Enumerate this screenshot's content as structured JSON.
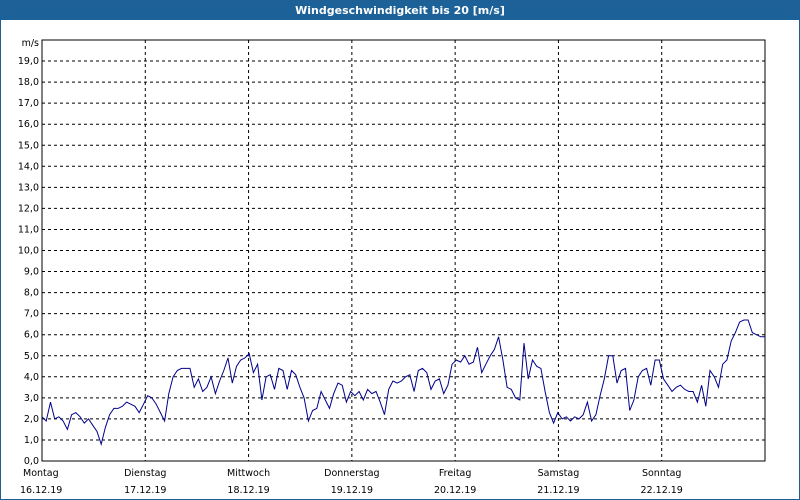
{
  "window": {
    "title": "Windgeschwindigkeit bis 20 [m/s]"
  },
  "chart_data": {
    "type": "line",
    "title": "Windgeschwindigkeit bis 20 [m/s]",
    "ylabel": "m/s",
    "ylim": [
      0,
      20
    ],
    "yticks": [
      "0,0",
      "1,0",
      "2,0",
      "3,0",
      "4,0",
      "5,0",
      "6,0",
      "7,0",
      "8,0",
      "9,0",
      "10,0",
      "11,0",
      "12,0",
      "13,0",
      "14,0",
      "15,0",
      "16,0",
      "17,0",
      "18,0",
      "19,0"
    ],
    "xlim": [
      0,
      7
    ],
    "days": [
      {
        "day": "Montag",
        "date": "16.12.19"
      },
      {
        "day": "Dienstag",
        "date": "17.12.19"
      },
      {
        "day": "Mittwoch",
        "date": "18.12.19"
      },
      {
        "day": "Donnerstag",
        "date": "19.12.19"
      },
      {
        "day": "Freitag",
        "date": "20.12.19"
      },
      {
        "day": "Samstag",
        "date": "21.12.19"
      },
      {
        "day": "Sonntag",
        "date": "22.12.19"
      }
    ],
    "grid": true,
    "color": "#00008b",
    "series": [
      {
        "values": [
          2.1,
          1.9,
          2.8,
          2.0,
          2.1,
          1.9,
          1.5,
          2.2,
          2.3,
          2.1,
          1.8,
          2.0,
          1.7,
          1.4,
          0.8,
          1.6,
          2.2,
          2.5,
          2.5,
          2.6,
          2.8,
          2.7,
          2.6,
          2.3,
          2.7,
          3.1,
          3.0,
          2.7,
          2.3,
          1.9,
          3.2,
          4.0,
          4.3,
          4.4,
          4.4,
          4.4,
          3.5,
          3.9,
          3.3,
          3.5,
          4.0,
          3.2,
          3.8,
          4.3,
          4.9,
          3.7,
          4.5,
          4.8,
          4.9,
          5.1,
          4.2,
          4.6,
          2.9,
          4.0,
          4.1,
          3.4,
          4.4,
          4.3,
          3.4,
          4.3,
          4.1,
          3.5,
          3.0,
          1.9,
          2.4,
          2.5,
          3.3,
          2.9,
          2.5,
          3.2,
          3.7,
          3.6,
          2.8,
          3.3,
          3.1,
          3.3,
          2.9,
          3.4,
          3.2,
          3.3,
          2.8,
          2.2,
          3.4,
          3.8,
          3.7,
          3.8,
          4.0,
          4.1,
          3.3,
          4.3,
          4.4,
          4.2,
          3.4,
          3.8,
          3.9,
          3.2,
          3.6,
          4.6,
          4.8,
          4.7,
          5.0,
          4.6,
          4.7,
          5.4,
          4.2,
          4.6,
          5.0,
          5.3,
          5.9,
          4.8,
          3.5,
          3.4,
          3.0,
          2.9,
          5.6,
          3.9,
          4.8,
          4.5,
          4.4,
          3.3,
          2.3,
          1.8,
          2.3,
          2.0,
          2.1,
          1.9,
          2.1,
          2.0,
          2.2,
          2.8,
          1.9,
          2.2,
          3.1,
          3.9,
          5.0,
          5.0,
          3.7,
          4.3,
          4.4,
          2.4,
          2.9,
          4.0,
          4.3,
          4.4,
          3.6,
          4.8,
          4.8,
          3.9,
          3.6,
          3.3,
          3.5,
          3.6,
          3.4,
          3.3,
          3.3,
          2.8,
          3.6,
          2.6,
          4.3,
          4.0,
          3.5,
          4.6,
          4.8,
          5.7,
          6.1,
          6.6,
          6.7,
          6.7,
          6.1,
          6.0,
          5.9,
          5.9
        ]
      }
    ]
  }
}
